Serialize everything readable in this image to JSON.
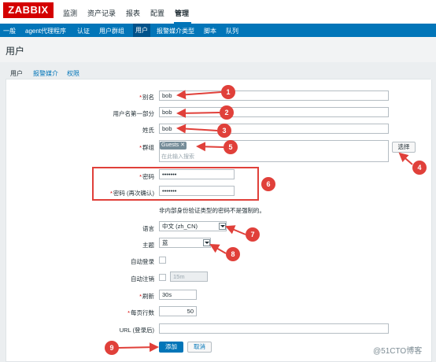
{
  "logo": "ZABBIX",
  "main_nav": [
    "监测",
    "资产记录",
    "报表",
    "配置",
    "管理"
  ],
  "sub_nav": [
    "一般",
    "agent代理程序",
    "认证",
    "用户群组",
    "用户",
    "报警媒介类型",
    "脚本",
    "队列"
  ],
  "page_title": "用户",
  "tabs": [
    "用户",
    "报警媒介",
    "权限"
  ],
  "form": {
    "alias_label": "别名",
    "alias_value": "bob",
    "name_label": "用户名第一部分",
    "name_value": "bob",
    "surname_label": "姓氏",
    "surname_value": "bob",
    "groups_label": "群组",
    "group_tag": "Guests",
    "groups_placeholder": "在此输入搜索",
    "select_button": "选择",
    "password_label": "密码",
    "password_value": "•••••••",
    "password2_label": "密码 (再次确认)",
    "password2_value": "•••••••",
    "password_note": "非内部身份验证类型的密码不是强制的。",
    "language_label": "语言",
    "language_value": "中文 (zh_CN)",
    "theme_label": "主题",
    "theme_value": "蓝",
    "autologin_label": "自动登录",
    "autologout_label": "自动注销",
    "autologout_value": "15m",
    "refresh_label": "刷新",
    "refresh_value": "30s",
    "rows_label": "每页行数",
    "rows_value": "50",
    "url_label": "URL (登录后)",
    "url_value": "",
    "add_button": "添加",
    "cancel_button": "取消"
  },
  "markers": [
    "1",
    "2",
    "3",
    "4",
    "5",
    "6",
    "7",
    "8",
    "9"
  ],
  "watermark": "@51CTO博客",
  "colors": {
    "brand": "#d40000",
    "accent": "#0275b8",
    "annotation": "#e0403a"
  }
}
